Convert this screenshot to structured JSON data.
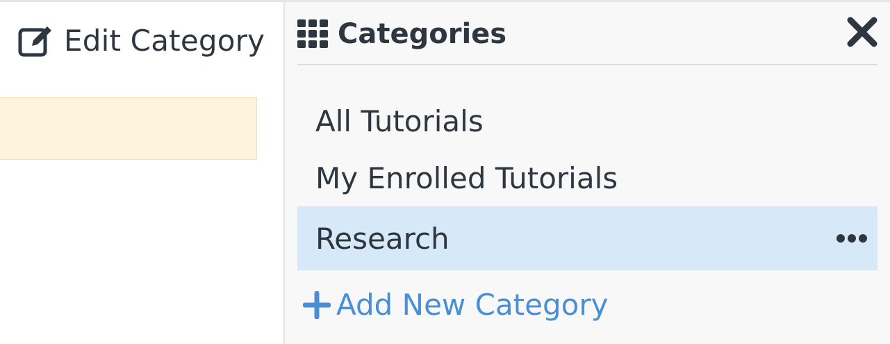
{
  "edit_pane": {
    "title": "Edit Category",
    "title_icon": "edit-icon"
  },
  "categories_panel": {
    "title": "Categories",
    "title_icon": "grid-icon",
    "close_icon": "close-icon",
    "items": [
      {
        "label": "All Tutorials",
        "selected": false
      },
      {
        "label": "My Enrolled Tutorials",
        "selected": false
      },
      {
        "label": "Research",
        "selected": true,
        "menu_icon": "more-horizontal-icon"
      }
    ],
    "add_label": "Add New Category",
    "add_icon": "plus-icon"
  },
  "colors": {
    "text": "#2e3640",
    "accent_link": "#4a8ed6",
    "selected_row": "#d7e8f8",
    "notice_background": "#fcf4dd",
    "panel_background": "#f8f8f8"
  }
}
